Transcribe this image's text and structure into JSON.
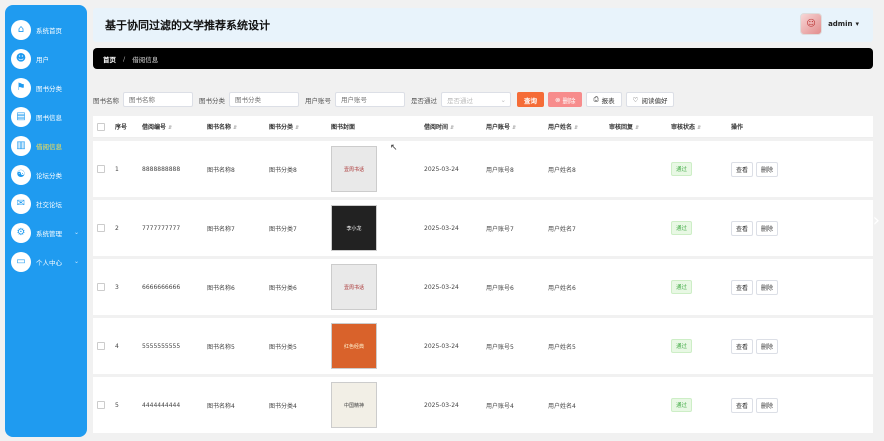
{
  "app": {
    "title": "基于协同过滤的文学推荐系统设计"
  },
  "user": {
    "name": "admin",
    "caret": "▾"
  },
  "sidebar": {
    "items": [
      {
        "label": "系统首页",
        "icon": "⌂",
        "icon_name": "home-icon",
        "active": false
      },
      {
        "label": "用户",
        "icon": "☻",
        "icon_name": "user-icon",
        "active": false
      },
      {
        "label": "图书分类",
        "icon": "⚑",
        "icon_name": "flag-icon",
        "active": false
      },
      {
        "label": "图书信息",
        "icon": "▤",
        "icon_name": "book-icon",
        "active": false
      },
      {
        "label": "借阅信息",
        "icon": "▥",
        "icon_name": "borrow-icon",
        "active": true
      },
      {
        "label": "论坛分类",
        "icon": "☯",
        "icon_name": "forum-category-icon",
        "active": false
      },
      {
        "label": "社交论坛",
        "icon": "✉",
        "icon_name": "forum-icon",
        "active": false
      },
      {
        "label": "系统管理",
        "icon": "⚙",
        "icon_name": "settings-icon",
        "active": false,
        "caret": "⌄"
      },
      {
        "label": "个人中心",
        "icon": "▭",
        "icon_name": "profile-icon",
        "active": false,
        "caret": "⌄"
      }
    ]
  },
  "breadcrumb": {
    "home": "首页",
    "separator": "/",
    "current": "借阅信息"
  },
  "filters": {
    "book_name_label": "图书名称",
    "book_name_placeholder": "图书名称",
    "book_category_label": "图书分类",
    "book_category_placeholder": "图书分类",
    "user_account_label": "用户账号",
    "user_account_placeholder": "用户账号",
    "passed_label": "是否通过",
    "passed_placeholder": "是否通过"
  },
  "actions": {
    "query": "查询",
    "delete": "删除",
    "report": "报表",
    "reading_pref": "阅读偏好"
  },
  "table": {
    "headers": [
      "",
      "序号",
      "借阅编号",
      "图书名称",
      "图书分类",
      "图书封面",
      "借阅时间",
      "用户账号",
      "用户姓名",
      "审核回复",
      "审核状态",
      "操作"
    ],
    "view_label": "查看",
    "delete_label": "删除",
    "rows": [
      {
        "no": "1",
        "borrow_no": "8888888888",
        "book_name": "图书名称8",
        "category": "图书分类8",
        "time": "2025-03-24",
        "account": "用户账号8",
        "name": "用户姓名8",
        "reply": "",
        "status": "通过",
        "cover_text": "壹周书话",
        "cover_bg": "#e9e9e9",
        "cover_fg": "#a33"
      },
      {
        "no": "2",
        "borrow_no": "7777777777",
        "book_name": "图书名称7",
        "category": "图书分类7",
        "time": "2025-03-24",
        "account": "用户账号7",
        "name": "用户姓名7",
        "reply": "",
        "status": "通过",
        "cover_text": "李小龙",
        "cover_bg": "#222",
        "cover_fg": "#fff"
      },
      {
        "no": "3",
        "borrow_no": "6666666666",
        "book_name": "图书名称6",
        "category": "图书分类6",
        "time": "2025-03-24",
        "account": "用户账号6",
        "name": "用户姓名6",
        "reply": "",
        "status": "通过",
        "cover_text": "壹周书话",
        "cover_bg": "#e9e9e9",
        "cover_fg": "#a33"
      },
      {
        "no": "4",
        "borrow_no": "5555555555",
        "book_name": "图书名称5",
        "category": "图书分类5",
        "time": "2025-03-24",
        "account": "用户账号5",
        "name": "用户姓名5",
        "reply": "",
        "status": "通过",
        "cover_text": "红色经典",
        "cover_bg": "#d9622b",
        "cover_fg": "#fff3d0"
      },
      {
        "no": "5",
        "borrow_no": "4444444444",
        "book_name": "图书名称4",
        "category": "图书分类4",
        "time": "2025-03-24",
        "account": "用户账号4",
        "name": "用户姓名4",
        "reply": "",
        "status": "通过",
        "cover_text": "中国精神",
        "cover_bg": "#f2efe6",
        "cover_fg": "#444"
      }
    ]
  },
  "colors": {
    "sidebar": "#1f9bf0",
    "active": "#ffe14d",
    "query": "#f56c37",
    "delete": "#f78c8c",
    "badge": "#4caf50"
  }
}
